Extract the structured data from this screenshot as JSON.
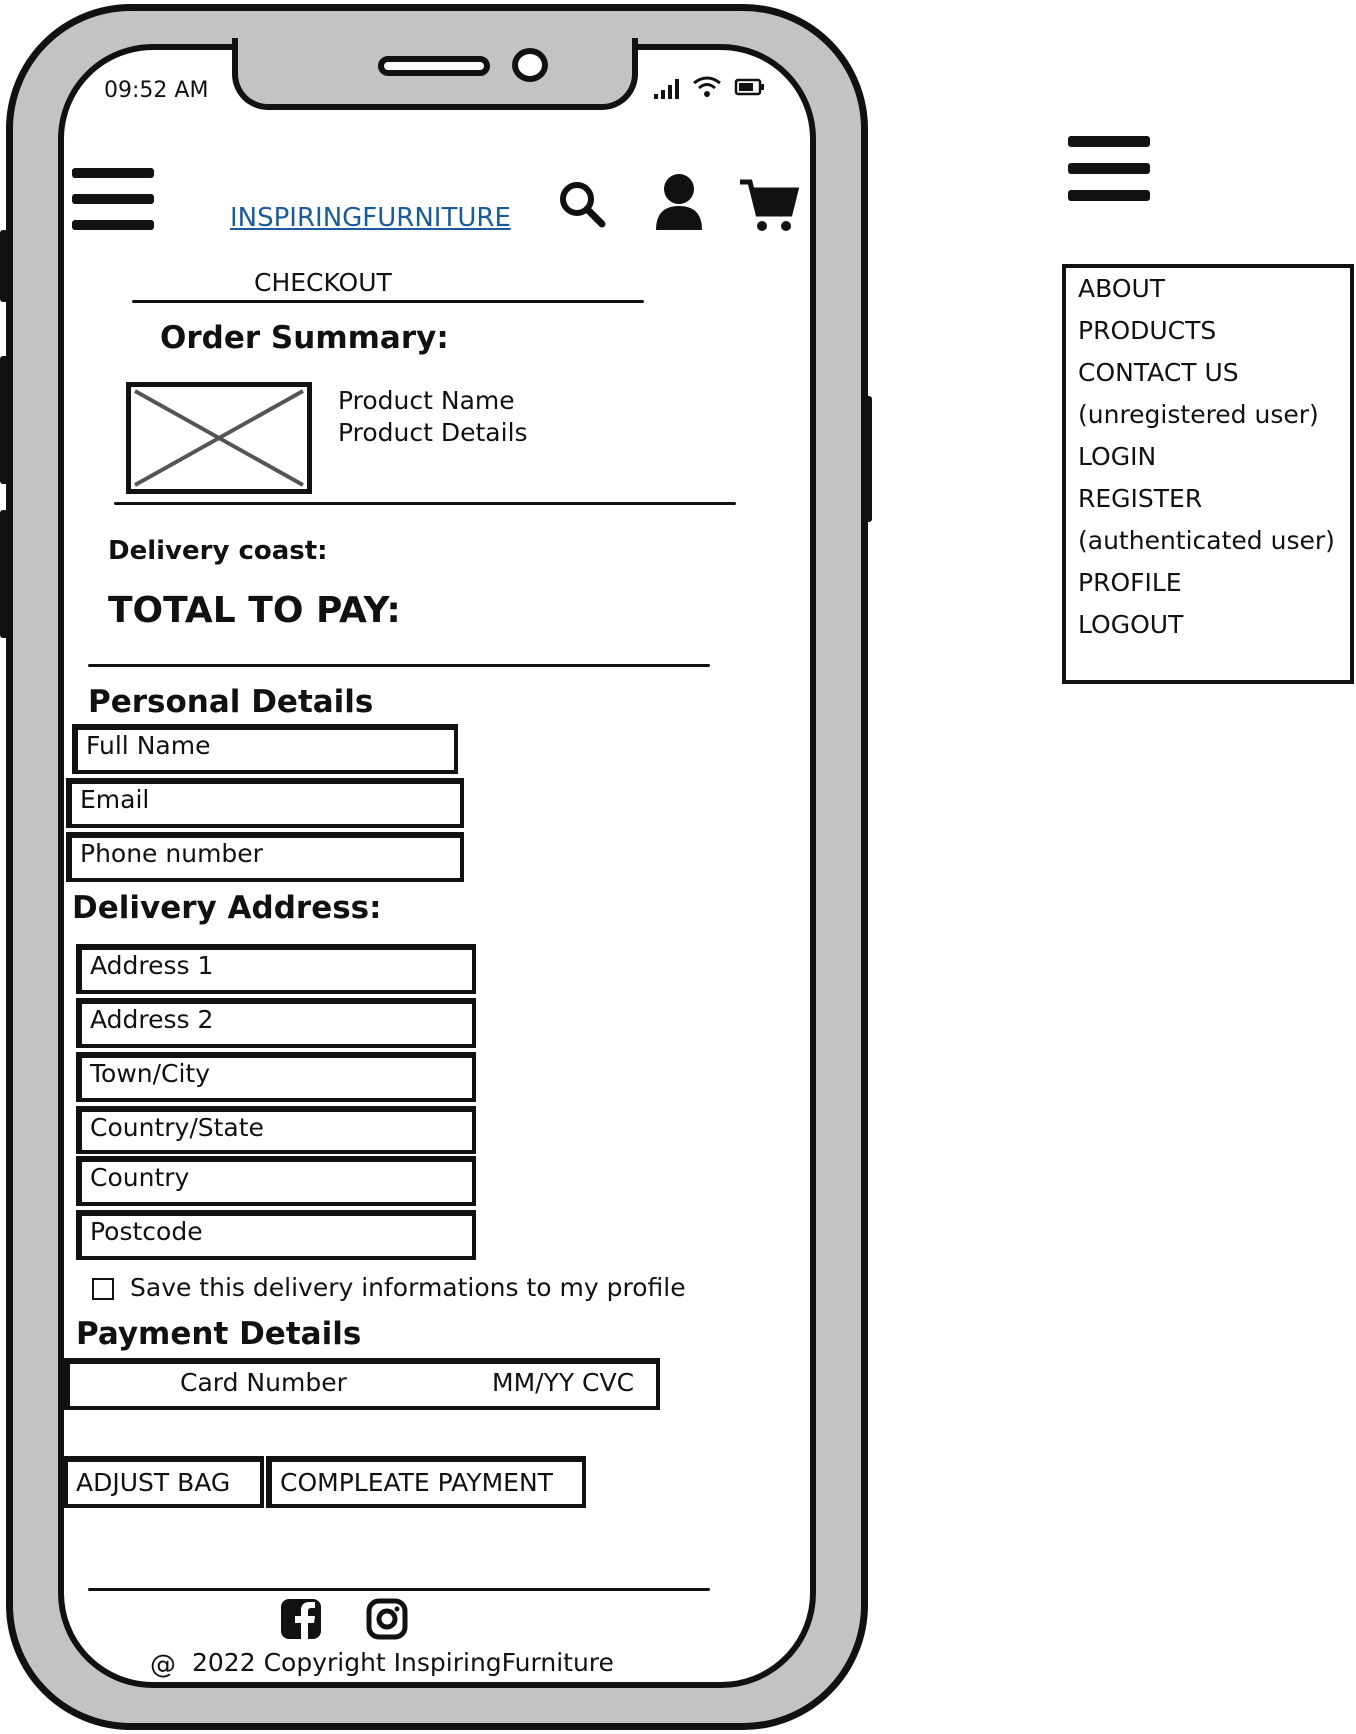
{
  "status_bar": {
    "time": "09:52 AM"
  },
  "header": {
    "brand": "INSPIRINGFURNITURE"
  },
  "checkout": {
    "title": "CHECKOUT",
    "order_summary_title": "Order Summary:",
    "product_name": "Product Name",
    "product_details": "Product Details",
    "delivery_cost_label": "Delivery coast:",
    "total_label": "TOTAL TO PAY:"
  },
  "personal_details": {
    "title": "Personal Details",
    "fields": [
      "Full Name",
      "Email",
      "Phone number"
    ]
  },
  "delivery_address": {
    "title": "Delivery Address:",
    "fields": [
      "Address 1",
      "Address 2",
      "Town/City",
      "Country/State",
      "Country",
      "Postcode"
    ],
    "save_label": "Save this delivery informations to my profile",
    "save_checked": false
  },
  "payment": {
    "title": "Payment Details",
    "card_number_placeholder": "Card Number",
    "expiry_cvc_placeholder": "MM/YY CVC"
  },
  "actions": {
    "adjust_bag_label": "ADJUST BAG",
    "complete_payment_label": "COMPLEATE PAYMENT"
  },
  "footer": {
    "copyright_symbol": "@",
    "copyright_text": "2022 Copyright InspiringFurniture",
    "social_icons": [
      "facebook-icon",
      "instagram-icon"
    ]
  },
  "side_menu": {
    "items": [
      "ABOUT",
      "PRODUCTS",
      "CONTACT US",
      "(unregistered user)",
      "LOGIN",
      "REGISTER",
      "(authenticated user)",
      "PROFILE",
      "LOGOUT"
    ]
  },
  "colors": {
    "brand_link": "#1a5c99",
    "phone_frame": "#c3c3c3",
    "ink": "#111111"
  }
}
